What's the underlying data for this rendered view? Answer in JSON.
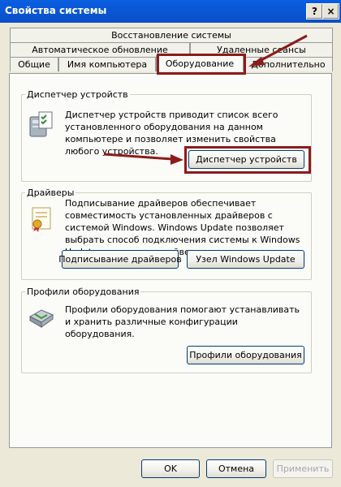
{
  "window": {
    "title": "Свойства системы"
  },
  "titlebar_buttons": {
    "help": "?",
    "close": "×"
  },
  "tabs": {
    "row1": [
      "Восстановление системы"
    ],
    "row2": [
      "Автоматическое обновление",
      "Удаленные сеансы"
    ],
    "row3": [
      "Общие",
      "Имя компьютера",
      "Оборудование",
      "Дополнительно"
    ],
    "active": "Оборудование"
  },
  "device_manager": {
    "legend": "Диспетчер устройств",
    "description": "Диспетчер устройств приводит список всего установленного оборудования на данном компьютере и позволяет изменить свойства любого устройства.",
    "button": "Диспетчер устройств"
  },
  "drivers": {
    "legend": "Драйверы",
    "description": "Подписывание драйверов обеспечивает совместимость установленных драйверов с системой Windows. Windows Update позволяет выбрать способ подключения системы к Windows Update для поиска драйверов.",
    "button_signing": "Подписывание драйверов",
    "button_update": "Узел Windows Update"
  },
  "hw_profiles": {
    "legend": "Профили оборудования",
    "description": "Профили оборудования помогают устанавливать и хранить различные конфигурации оборудования.",
    "button": "Профили оборудования"
  },
  "footer": {
    "ok": "OK",
    "cancel": "Отмена",
    "apply": "Применить"
  },
  "colors": {
    "title_bar": "#0a57d6",
    "annotation": "#8b1c1c"
  }
}
